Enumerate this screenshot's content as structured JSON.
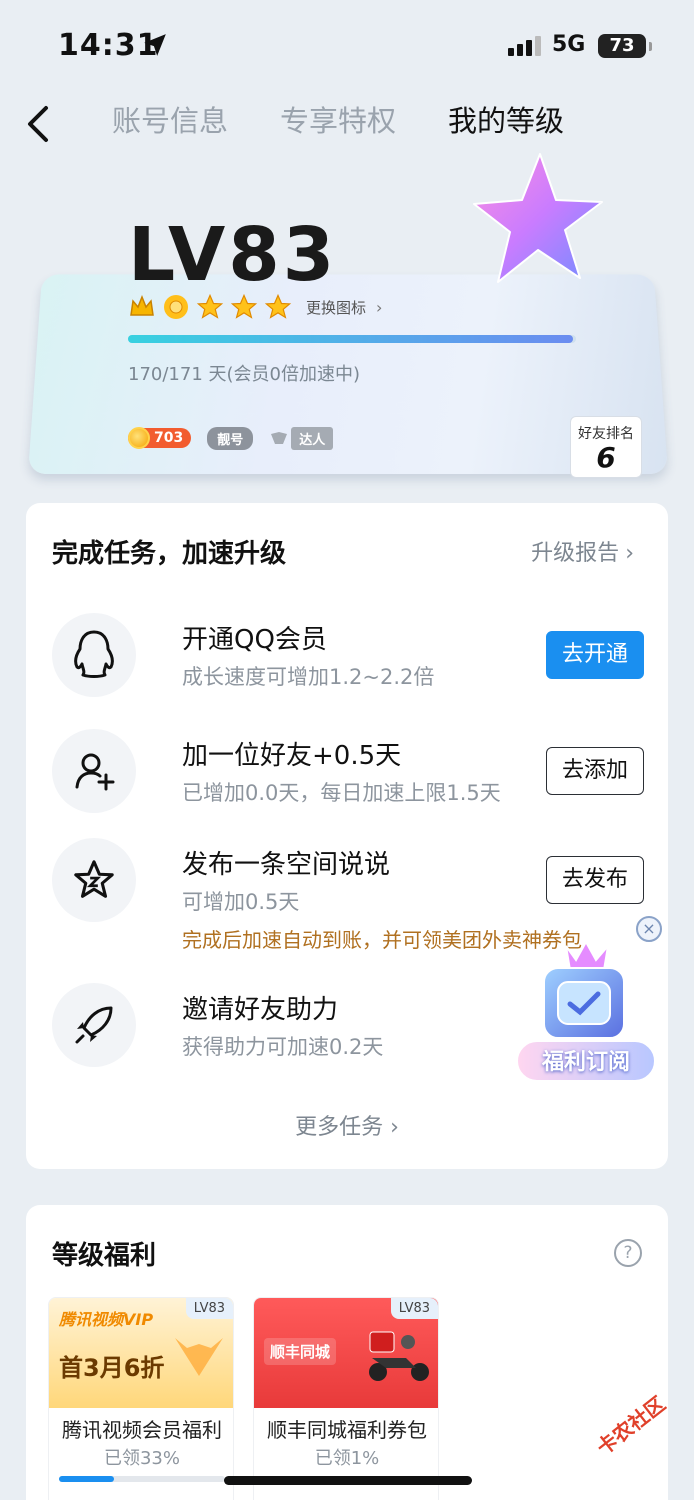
{
  "status": {
    "time": "14:31",
    "network": "5G",
    "battery": "73"
  },
  "nav": {
    "tabs": [
      "账号信息",
      "专享特权",
      "我的等级"
    ],
    "active_index": 2
  },
  "level": {
    "title": "LV83",
    "change_icon_label": "更换图标",
    "progress": 0.994,
    "days_text": "170/171 天(会员0倍加速中)",
    "coin_value": "703",
    "pretty_badge": "靓号",
    "expert_badge": "达人",
    "rank_label": "好友排名",
    "rank_value": "6"
  },
  "tasks_panel": {
    "title": "完成任务，加速升级",
    "report_link": "升级报告",
    "tasks": [
      {
        "title": "开通QQ会员",
        "sub": "成长速度可增加1.2~2.2倍",
        "button": "去开通",
        "icon": "penguin-icon"
      },
      {
        "title": "加一位好友+0.5天",
        "sub": "已增加0.0天，每日加速上限1.5天",
        "button": "去添加",
        "icon": "add-friend-icon"
      },
      {
        "title": "发布一条空间说说",
        "sub": "可增加0.5天",
        "note": "完成后加速自动到账，并可领美团外卖神券包",
        "button": "去发布",
        "icon": "qzone-star-icon"
      },
      {
        "title": "邀请好友助力",
        "sub": "获得助力可加速0.2天",
        "icon": "rocket-icon"
      }
    ],
    "more": "更多任务",
    "promo_label": "福利订阅"
  },
  "benefits_panel": {
    "title": "等级福利",
    "items": [
      {
        "tag": "LV83",
        "name": "腾讯视频会员福利",
        "claimed": "已领33%",
        "progress": 0.33,
        "image_text_brand": "腾讯视频VIP",
        "image_text_offer": "首3月6折"
      },
      {
        "tag": "LV83",
        "name": "顺丰同城福利券包",
        "claimed": "已领1%",
        "progress": 0.01,
        "image_text_brand": "顺丰同城"
      }
    ]
  },
  "watermark": "卡农社区",
  "colors": {
    "primary": "#1a8ff0",
    "note": "#b07020",
    "background": "#e9eef3"
  }
}
